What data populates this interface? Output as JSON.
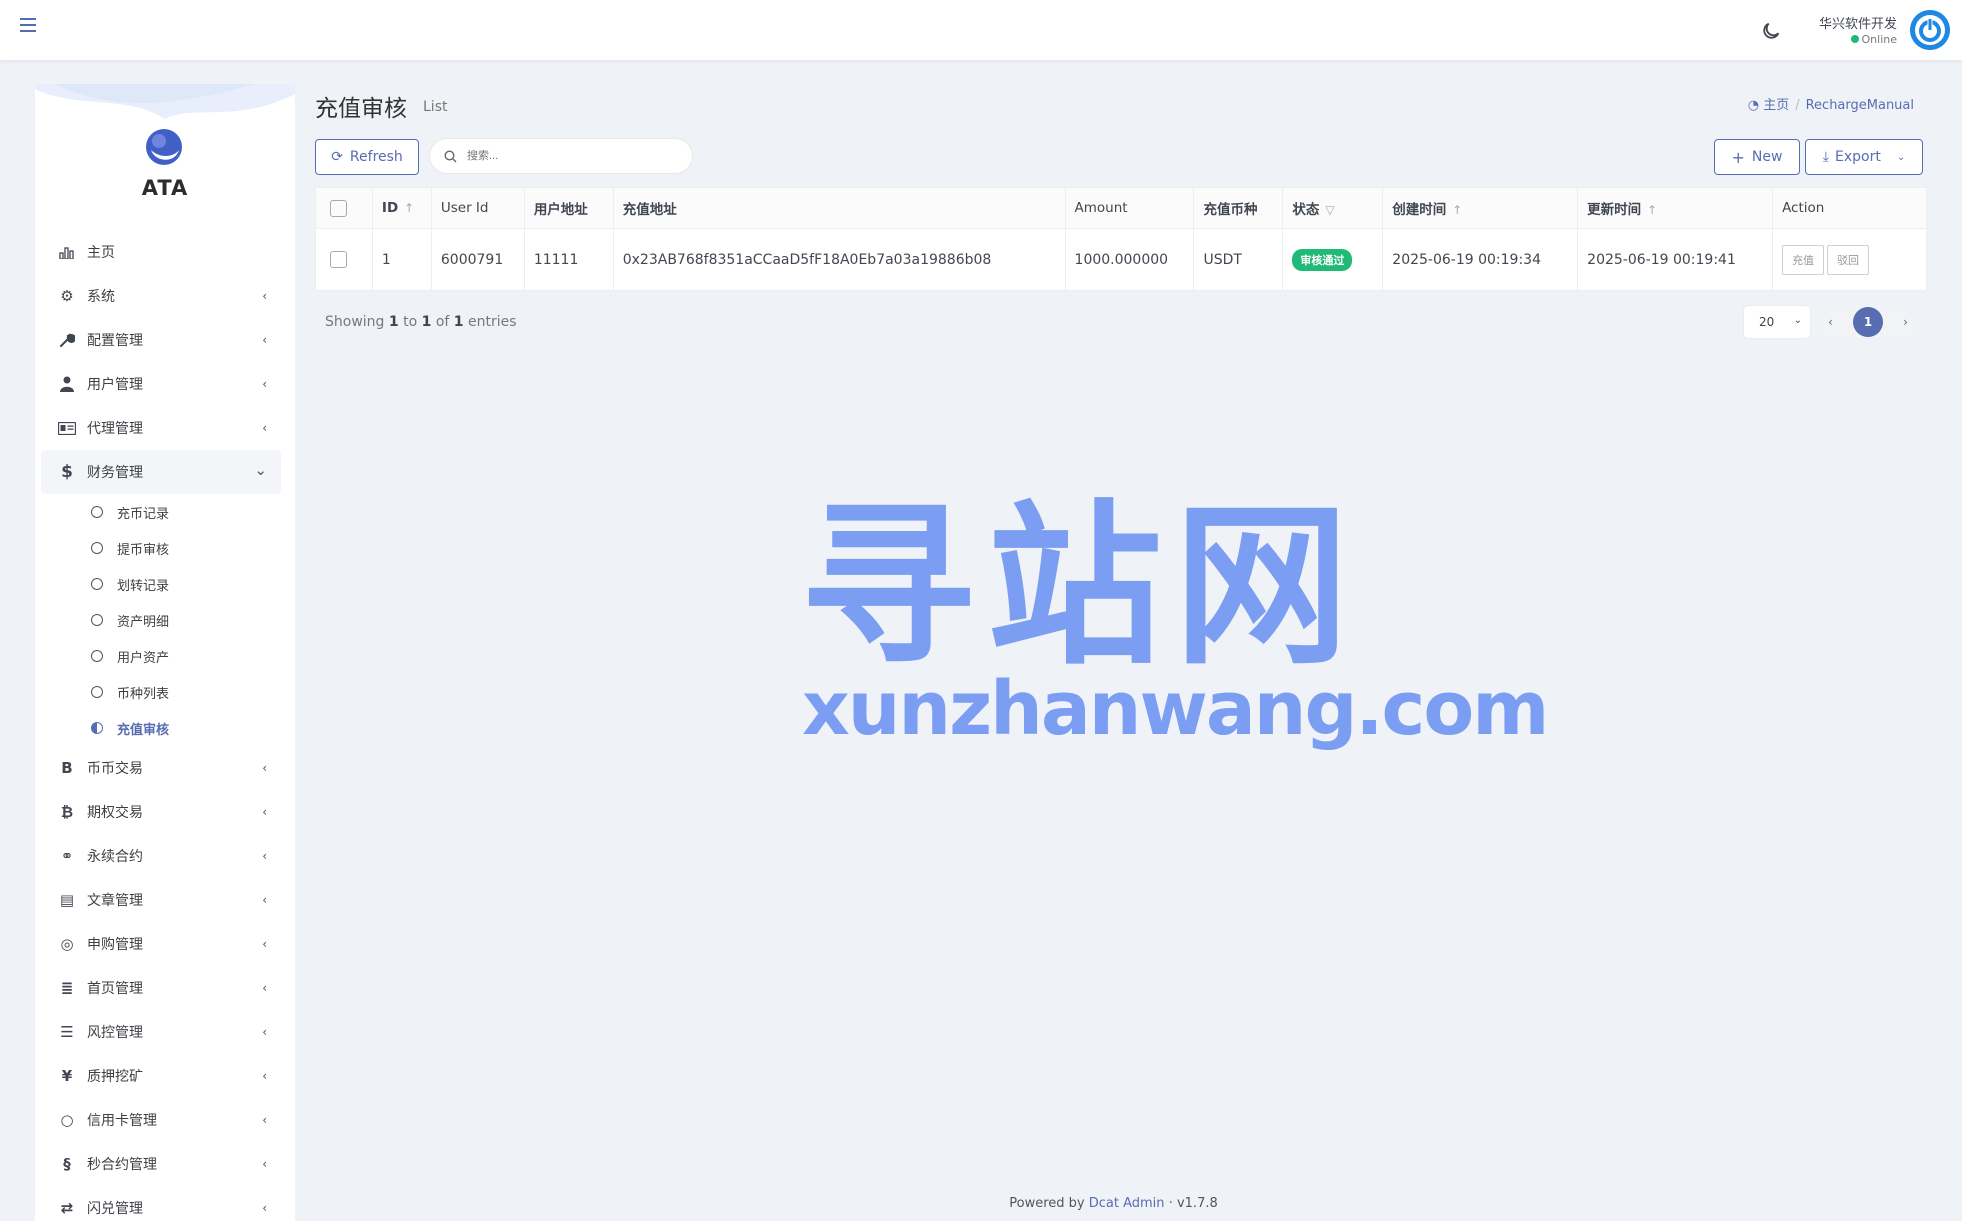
{
  "user": {
    "name": "华兴软件开发",
    "status": "Online"
  },
  "logo": {
    "text": "ATA"
  },
  "menu": [
    {
      "label": "主页",
      "icon": "bar-chart-icon",
      "arrow": ""
    },
    {
      "label": "系统",
      "icon": "gear-icon",
      "arrow": "‹"
    },
    {
      "label": "配置管理",
      "icon": "wrench-icon",
      "arrow": "‹"
    },
    {
      "label": "用户管理",
      "icon": "user-icon",
      "arrow": "‹"
    },
    {
      "label": "代理管理",
      "icon": "id-card-icon",
      "arrow": "‹"
    },
    {
      "label": "财务管理",
      "icon": "dollar-icon",
      "arrow": "⌄"
    }
  ],
  "submenu": [
    {
      "label": "充币记录"
    },
    {
      "label": "提币审核"
    },
    {
      "label": "划转记录"
    },
    {
      "label": "资产明细"
    },
    {
      "label": "用户资产"
    },
    {
      "label": "币种列表"
    },
    {
      "label": "充值审核"
    }
  ],
  "menu2": [
    {
      "label": "币币交易",
      "icon": "bitcoin-b-icon",
      "glyph": "B"
    },
    {
      "label": "期权交易",
      "icon": "bitcoin-icon",
      "glyph": "₿"
    },
    {
      "label": "永续合约",
      "icon": "link-icon",
      "glyph": "⚭"
    },
    {
      "label": "文章管理",
      "icon": "newspaper-icon",
      "glyph": "▤"
    },
    {
      "label": "申购管理",
      "icon": "life-ring-icon",
      "glyph": "◎"
    },
    {
      "label": "首页管理",
      "icon": "list-icon",
      "glyph": "≣"
    },
    {
      "label": "风控管理",
      "icon": "indent-icon",
      "glyph": "☰"
    },
    {
      "label": "质押挖矿",
      "icon": "yen-icon",
      "glyph": "¥"
    },
    {
      "label": "信用卡管理",
      "icon": "circle-icon",
      "glyph": "○"
    },
    {
      "label": "秒合约管理",
      "icon": "coins-icon",
      "glyph": "§"
    },
    {
      "label": "闪兑管理",
      "icon": "exchange-icon",
      "glyph": "⇄"
    }
  ],
  "page": {
    "title": "充值审核",
    "subtitle": "List"
  },
  "breadcrumb": {
    "home": "主页",
    "current": "RechargeManual"
  },
  "toolbar": {
    "refresh": "Refresh",
    "search_placeholder": "搜索...",
    "new": "New",
    "export": "Export"
  },
  "table": {
    "headers": [
      "ID",
      "User Id",
      "用户地址",
      "充值地址",
      "Amount",
      "充值币种",
      "状态",
      "创建时间",
      "更新时间",
      "Action"
    ],
    "rows": [
      {
        "id": "1",
        "user_id": "6000791",
        "user_address": "11111",
        "recharge_address": "0x23AB768f8351aCCaaD5fF18A0Eb7a03a19886b08",
        "amount": "1000.000000",
        "currency": "USDT",
        "status": "审核通过",
        "created": "2025-06-19 00:19:34",
        "updated": "2025-06-19 00:19:41",
        "actions": [
          "充值",
          "驳回"
        ]
      }
    ]
  },
  "pagination": {
    "showing_prefix": "Showing",
    "from": "1",
    "to_word": "to",
    "to": "1",
    "of_word": "of",
    "total": "1",
    "entries_word": "entries",
    "per_page": "20",
    "current": "1"
  },
  "watermark": {
    "cn": "寻站网",
    "en": "xunzhanwang.com"
  },
  "footer": {
    "prefix": "Powered by",
    "link": "Dcat Admin",
    "sep": "·",
    "version": "v1.7.8"
  },
  "colors": {
    "primary": "#586cb1",
    "success": "#21b978",
    "watermark": "#7b9ef3"
  }
}
